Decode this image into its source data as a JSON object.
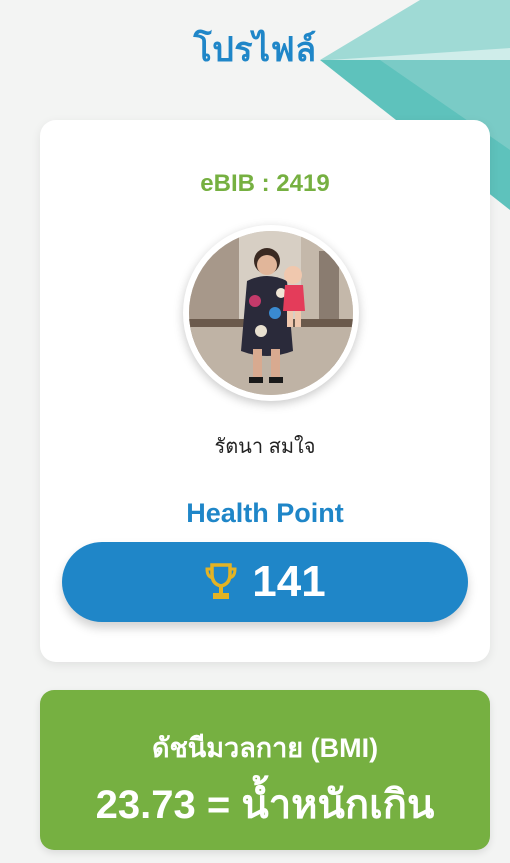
{
  "header": {
    "title": "โปรไฟล์"
  },
  "profile": {
    "ebib": "eBIB : 2419",
    "name": "รัตนา สมใจ",
    "avatar_icon": "user-photo"
  },
  "health_point": {
    "label": "Health Point",
    "value": "141",
    "icon": "trophy-icon"
  },
  "bmi": {
    "label": "ดัชนีมวลกาย (BMI)",
    "result": "23.73 = น้ำหนักเกิน"
  },
  "colors": {
    "primary_blue": "#1f86c8",
    "accent_green": "#76b041",
    "trophy_gold": "#e3b324",
    "teal_decoration": "#5ec2bc",
    "background": "#f3f4f3"
  }
}
